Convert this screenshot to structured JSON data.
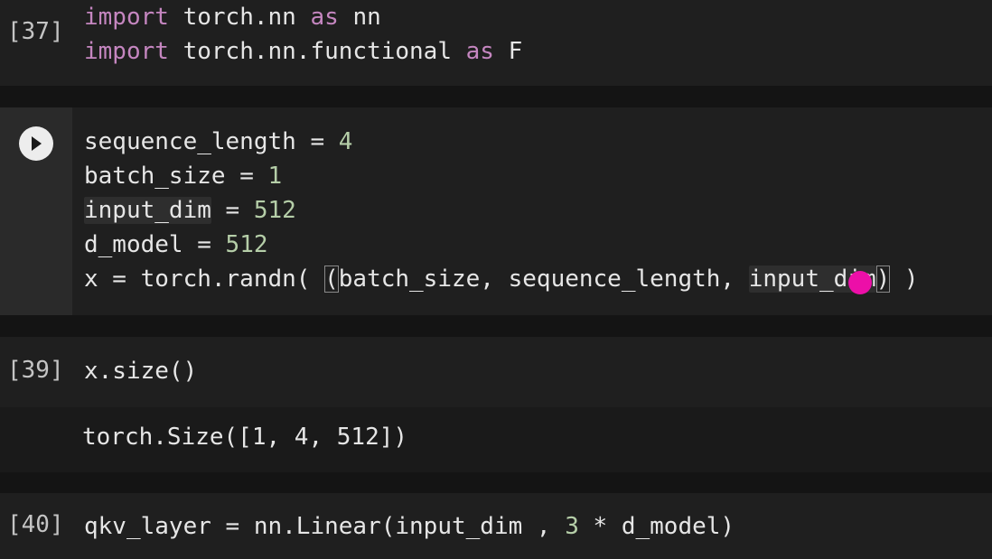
{
  "cells": {
    "imports": {
      "exec_count": "[37]",
      "line1": {
        "kw1": "import",
        "mod": "torch.nn",
        "kw2": "as",
        "alias": "nn"
      },
      "line2": {
        "kw1": "import",
        "mod": "torch.nn.functional",
        "kw2": "as",
        "alias": "F"
      }
    },
    "setup": {
      "run_button": "run-cell",
      "lines": {
        "l1_name": "sequence_length",
        "l1_eq": "=",
        "l1_val": "4",
        "l2_name": "batch_size",
        "l2_eq": "=",
        "l2_val": "1",
        "l3_name": "input_dim",
        "l3_eq": "=",
        "l3_val": "512",
        "l4_name": "d_model",
        "l4_eq": "=",
        "l4_val": "512",
        "l5_pre": "x = torch.randn( ",
        "l5_open": "(",
        "l5_args": "batch_size, sequence_length, ",
        "l5_last": "input_dim",
        "l5_close": ")",
        "l5_post": " )"
      }
    },
    "size": {
      "exec_count": "[39]",
      "code": "x.size()",
      "output": "torch.Size([1, 4, 512])"
    },
    "linear": {
      "exec_count": "[40]",
      "pre": "qkv_layer = nn.Linear(input_dim , ",
      "num": "3",
      "post": " * d_model)"
    }
  },
  "colors": {
    "keyword": "#c586c0",
    "number": "#b5cea8",
    "text": "#e6e6e6",
    "cursor": "#ec0fa8"
  }
}
